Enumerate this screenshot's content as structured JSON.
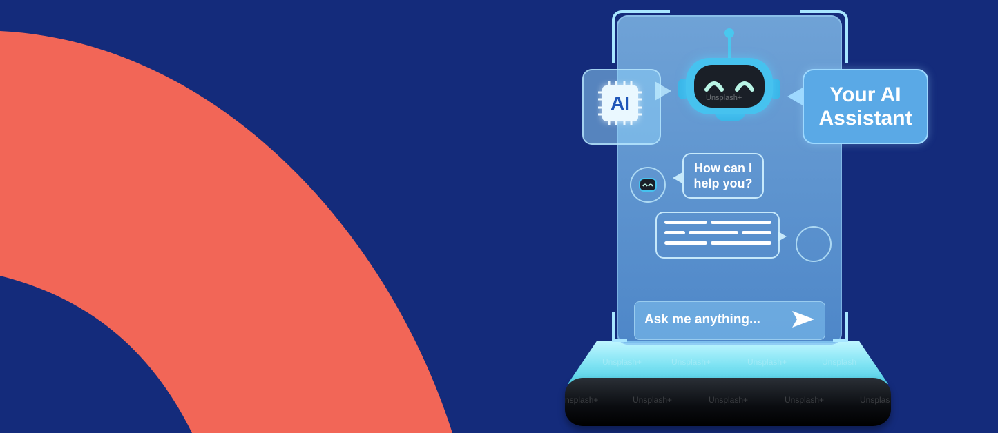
{
  "theme": {
    "background": "#142b7b",
    "arc_color": "#f26657",
    "glass_accent": "#46c2ef",
    "text_color": "#ffffff"
  },
  "hero": {
    "chip_label": "AI",
    "title_line1": "Your AI",
    "title_line2": "Assistant"
  },
  "chat": {
    "bot_message_line1": "How can I",
    "bot_message_line2": "help you?"
  },
  "input": {
    "placeholder": "Ask me anything..."
  },
  "watermarks": {
    "robot_face": "Unsplash+",
    "base_row1": [
      "Unsplash+",
      "Unsplash+",
      "Unsplash+",
      "Unsplash"
    ],
    "base_row2": [
      "nsplash+",
      "Unsplash+",
      "Unsplash+",
      "Unsplash+",
      "Unsplas"
    ]
  },
  "icons": {
    "chip": "ai-chip-icon",
    "robot": "robot-icon",
    "send": "send-arrow-icon"
  }
}
